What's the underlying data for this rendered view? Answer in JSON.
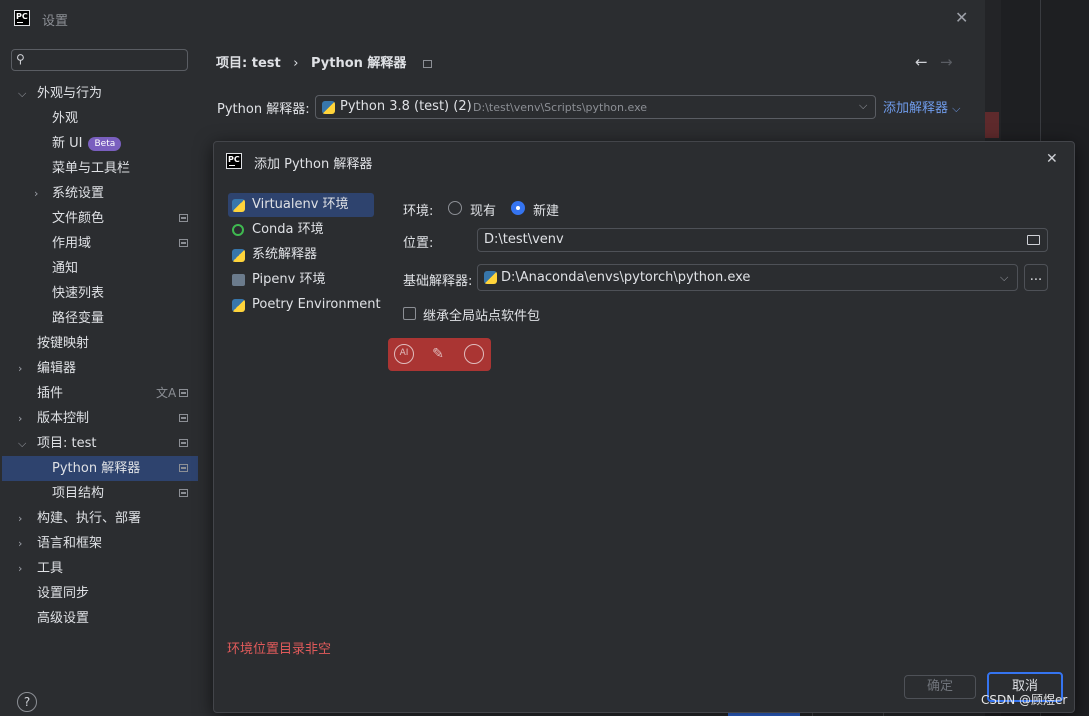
{
  "window": {
    "title": "设置",
    "logo_text": "PC"
  },
  "search": {
    "placeholder": ""
  },
  "sidebar": {
    "items": [
      {
        "label": "外观与行为",
        "expanded": true
      },
      {
        "label": "外观"
      },
      {
        "label": "新 UI",
        "badge": "Beta"
      },
      {
        "label": "菜单与工具栏"
      },
      {
        "label": "系统设置"
      },
      {
        "label": "文件颜色"
      },
      {
        "label": "作用域"
      },
      {
        "label": "通知"
      },
      {
        "label": "快速列表"
      },
      {
        "label": "路径变量"
      },
      {
        "label": "按键映射"
      },
      {
        "label": "编辑器"
      },
      {
        "label": "插件"
      },
      {
        "label": "版本控制"
      },
      {
        "label": "项目: test"
      },
      {
        "label": "Python 解释器"
      },
      {
        "label": "项目结构"
      },
      {
        "label": "构建、执行、部署"
      },
      {
        "label": "语言和框架"
      },
      {
        "label": "工具"
      },
      {
        "label": "设置同步"
      },
      {
        "label": "高级设置"
      }
    ]
  },
  "breadcrumb": {
    "project": "项目: test",
    "separator": "›",
    "page": "Python 解释器"
  },
  "interpreter": {
    "label": "Python 解释器:",
    "name": "Python 3.8 (test) (2)",
    "path": "D:\\test\\venv\\Scripts\\python.exe",
    "add_label": "添加解释器"
  },
  "dialog": {
    "title": "添加 Python 解释器",
    "types": [
      "Virtualenv 环境",
      "Conda 环境",
      "系统解释器",
      "Pipenv 环境",
      "Poetry Environment"
    ],
    "env_label": "环境:",
    "env_existing": "现有",
    "env_new": "新建",
    "location_label": "位置:",
    "location_value": "D:\\test\\venv",
    "base_label": "基础解释器:",
    "base_value": "D:\\Anaconda\\envs\\pytorch\\python.exe",
    "browse_label": "...",
    "inherit_label": "继承全局站点软件包",
    "error": "环境位置目录非空",
    "ok_label": "确定",
    "cancel_label": "取消"
  },
  "ai_toolbar": {
    "ai_label": "AI"
  },
  "watermark": "CSDN @顾煜er",
  "help_label": "?",
  "colors": {
    "accent": "#3574f0",
    "selection": "#2e436e",
    "error": "#e05a5a",
    "link": "#6f9bea"
  }
}
